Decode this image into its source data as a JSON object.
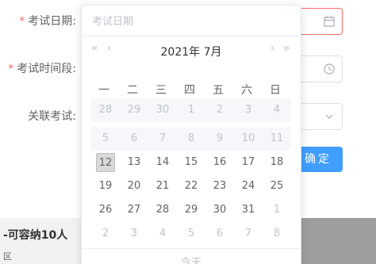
{
  "form": {
    "exam_date_label": "考试日期:",
    "exam_period_label": "考试时间段:",
    "related_exam_label": "关联考试:",
    "required_mark": "*",
    "confirm_label": "确定"
  },
  "background": {
    "room_text": "-可容纳10人",
    "area_text": "区"
  },
  "datepicker": {
    "placeholder": "考试日期",
    "title": "2021年 7月",
    "weekdays": [
      "一",
      "二",
      "三",
      "四",
      "五",
      "六",
      "日"
    ],
    "weeks": [
      [
        "28",
        "29",
        "30",
        "1",
        "2",
        "3",
        "4"
      ],
      [
        "5",
        "6",
        "7",
        "8",
        "9",
        "10",
        "11"
      ],
      [
        "12",
        "13",
        "14",
        "15",
        "16",
        "17",
        "18"
      ],
      [
        "19",
        "20",
        "21",
        "22",
        "23",
        "24",
        "25"
      ],
      [
        "26",
        "27",
        "28",
        "29",
        "30",
        "31",
        "1"
      ],
      [
        "2",
        "3",
        "4",
        "5",
        "6",
        "7",
        "8"
      ]
    ],
    "today_label": "今天",
    "nav": {
      "prev_year": "«",
      "prev_month": "‹",
      "next_month": "›",
      "next_year": "»"
    }
  },
  "colors": {
    "primary": "#409eff",
    "danger": "#f56c6c"
  },
  "icons": [
    "calendar-icon",
    "clock-icon",
    "chevron-down-icon"
  ]
}
